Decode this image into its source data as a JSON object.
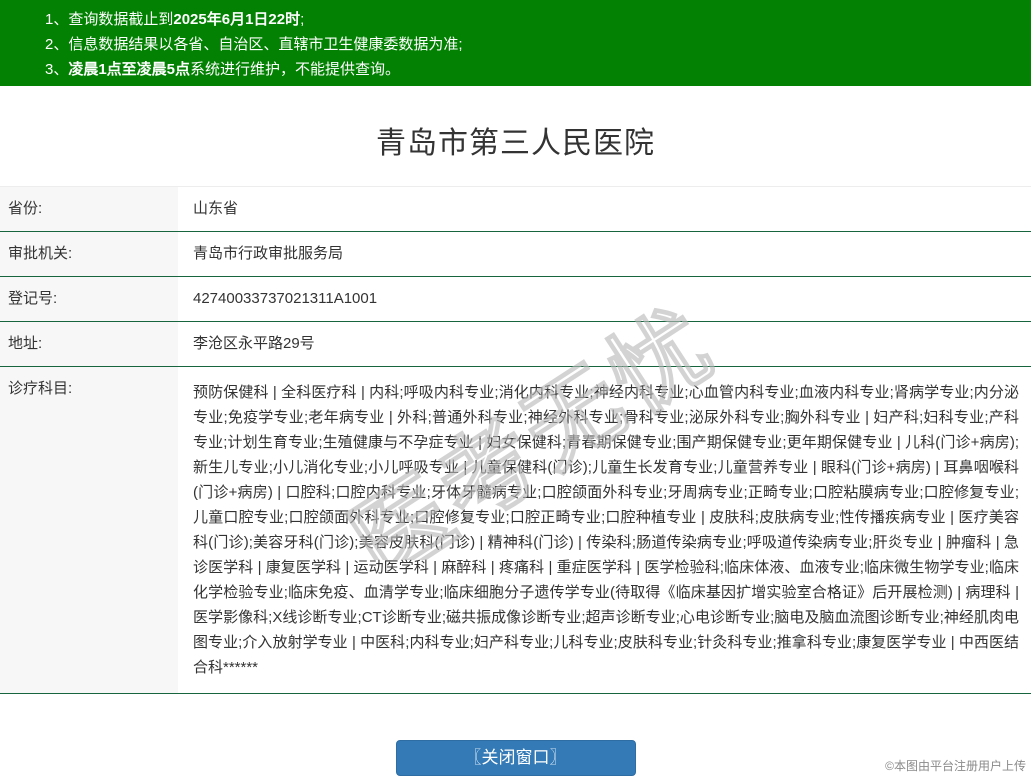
{
  "colors": {
    "header_green": "#028102",
    "row_border_green": "#17653F",
    "label_bg": "#F7F7F7",
    "button_blue": "#337AB7",
    "text": "#333333"
  },
  "notice": {
    "lines": [
      {
        "num": "1、",
        "pre": "查询数据截止到",
        "bold": "2025年6月1日22时",
        "post": ";"
      },
      {
        "num": "2、",
        "pre": "信息数据结果以各省、自治区、直辖市卫生健康委数据为准;",
        "bold": "",
        "post": ""
      },
      {
        "num": "3、",
        "pre": "",
        "bold": "凌晨1点至凌晨5点",
        "post": "系统进行维护，不能提供查询。"
      }
    ]
  },
  "page": {
    "title": "青岛市第三人民医院"
  },
  "fields": [
    {
      "label": "省份:",
      "value": "山东省"
    },
    {
      "label": "审批机关:",
      "value": "青岛市行政审批服务局"
    },
    {
      "label": "登记号:",
      "value": "42740033737021311A1001"
    },
    {
      "label": "地址:",
      "value": "李沧区永平路29号"
    },
    {
      "label": "诊疗科目:",
      "value": "预防保健科 | 全科医疗科 | 内科;呼吸内科专业;消化内科专业;神经内科专业;心血管内科专业;血液内科专业;肾病学专业;内分泌专业;免疫学专业;老年病专业 | 外科;普通外科专业;神经外科专业;骨科专业;泌尿外科专业;胸外科专业 | 妇产科;妇科专业;产科专业;计划生育专业;生殖健康与不孕症专业 | 妇女保健科;青春期保健专业;围产期保健专业;更年期保健专业 | 儿科(门诊+病房);新生儿专业;小儿消化专业;小儿呼吸专业 | 儿童保健科(门诊);儿童生长发育专业;儿童营养专业 | 眼科(门诊+病房) | 耳鼻咽喉科(门诊+病房) | 口腔科;口腔内科专业;牙体牙髓病专业;口腔颌面外科专业;牙周病专业;正畸专业;口腔粘膜病专业;口腔修复专业;儿童口腔专业;口腔颌面外科专业;口腔修复专业;口腔正畸专业;口腔种植专业 | 皮肤科;皮肤病专业;性传播疾病专业 | 医疗美容科(门诊);美容牙科(门诊);美容皮肤科(门诊) | 精神科(门诊) | 传染科;肠道传染病专业;呼吸道传染病专业;肝炎专业 | 肿瘤科 | 急诊医学科 | 康复医学科 | 运动医学科 | 麻醉科 | 疼痛科 | 重症医学科 | 医学检验科;临床体液、血液专业;临床微生物学专业;临床化学检验专业;临床免疫、血清学专业;临床细胞分子遗传学专业(待取得《临床基因扩增实验室合格证》后开展检测) | 病理科 | 医学影像科;X线诊断专业;CT诊断专业;磁共振成像诊断专业;超声诊断专业;心电诊断专业;脑电及脑血流图诊断专业;神经肌肉电图专业;介入放射学专业 | 中医科;内科专业;妇产科专业;儿科专业;皮肤科专业;针灸科专业;推拿科专业;康复医学专业 | 中西医结合科******"
    }
  ],
  "button": {
    "label": "〖关闭窗口〗"
  },
  "watermarks": {
    "diagonal": "医考无忧",
    "footer": "©本图由平台注册用户上传"
  }
}
